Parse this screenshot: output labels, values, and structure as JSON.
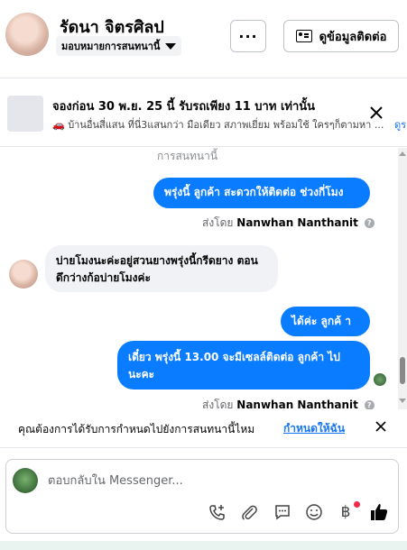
{
  "header": {
    "contact_name": "รัดนา จิตรศิลป",
    "assign_label": "มอบหมายการสนทนานี้",
    "more_label": "···",
    "view_contact_label": "ดูข้อมูลติดต่อ"
  },
  "ad": {
    "title": "จองก่อน 30 พ.ย. 25 นี้ รับรถเพียง 11 บาท เท่านั้น",
    "description": "🚗 บ้านอื่นสี่แสน ที่นี่3แสนกว่า มือเดียว สภาพเยี่ยม พร้อมใช้ ใครๆก็ตามหา ...",
    "link_fragment": "ดูร"
  },
  "chat": {
    "section_label": "การสนทนานี้",
    "messages": [
      {
        "direction": "out",
        "text": "พรุ่งนี้ ลูกค้า สะดวกให้ติดต่อ ช่วงกี่โมง"
      },
      {
        "direction": "meta",
        "prefix": "ส่งโดย",
        "sender": "Nanwhan Nanthanit"
      },
      {
        "direction": "in",
        "text": "บ่ายโมงนะค่ะอยู่สวนยางพรุ่งนี้กรีดยาง ตอนดึกว่างก้อบ่ายโมงค่ะ"
      },
      {
        "direction": "out",
        "text": "ได้ค่ะ  ลูกค้ า"
      },
      {
        "direction": "out",
        "text": "เดี๋ยว พรุ่งนี้ 13.00 จะมีเซลล์ติดต่อ ลูกค้า ไป นะคะ"
      },
      {
        "direction": "meta",
        "prefix": "ส่งโดย",
        "sender": "Nanwhan Nanthanit"
      }
    ]
  },
  "assign_prompt": {
    "question": "คุณต้องการได้รับการกำหนดไปยังการสนทนานี้ไหม",
    "action": "กำหนดให้ฉัน"
  },
  "composer": {
    "placeholder": "ตอบกลับใน Messenger...",
    "icons": [
      "call-add-icon",
      "attachment-icon",
      "saved-reply-icon",
      "emoji-icon",
      "baht-icon",
      "like-icon"
    ],
    "baht_glyph": "฿"
  },
  "colors": {
    "accent": "#0a7cff",
    "link": "#1877f2",
    "incoming_bubble": "#f0f2f5",
    "badge_red": "#f02849"
  }
}
